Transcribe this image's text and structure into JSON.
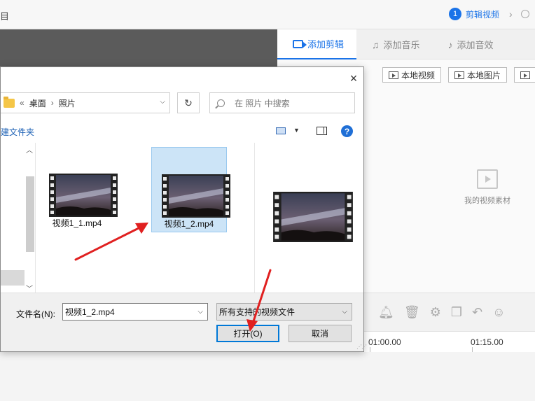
{
  "app": {
    "title_fragment": "目",
    "step": {
      "number": "1",
      "label": "剪辑视频",
      "chevron": "›"
    },
    "tabs": [
      {
        "label": "添加剪辑",
        "icon": "video-icon",
        "active": true
      },
      {
        "label": "添加音乐",
        "icon": "music-note-icon",
        "active": false
      },
      {
        "label": "添加音效",
        "icon": "sound-effect-icon",
        "active": false
      }
    ],
    "source_buttons": [
      {
        "label": "本地视频",
        "icon": "video-file-icon"
      },
      {
        "label": "本地图片",
        "icon": "image-file-icon"
      }
    ],
    "empty_media_label": "我的视频素材",
    "timeline": {
      "times": [
        "01:00.00",
        "01:15.00"
      ]
    },
    "tool_icons": [
      "bell-icon",
      "trash-icon",
      "crop-icon",
      "copy-icon",
      "undo-icon",
      "emoji-icon"
    ]
  },
  "dialog": {
    "close_label": "×",
    "breadcrumb": {
      "prefix": "«",
      "parent": "桌面",
      "separator": "›",
      "current": "照片"
    },
    "search_placeholder": "在 照片 中搜索",
    "new_folder_fragment": "建文件夹",
    "help_label": "?",
    "files": [
      {
        "name": "视频1_1.mp4",
        "selected": false
      },
      {
        "name": "视频1_2.mp4",
        "selected": true
      }
    ],
    "filename_label": "文件名(N):",
    "filename_value": "视频1_2.mp4",
    "filetype_value": "所有支持的视频文件",
    "open_label": "打开(O)",
    "cancel_label": "取消"
  },
  "colors": {
    "accent": "#1a73e8",
    "selection": "#cce4f7",
    "arrow": "#e02020"
  }
}
